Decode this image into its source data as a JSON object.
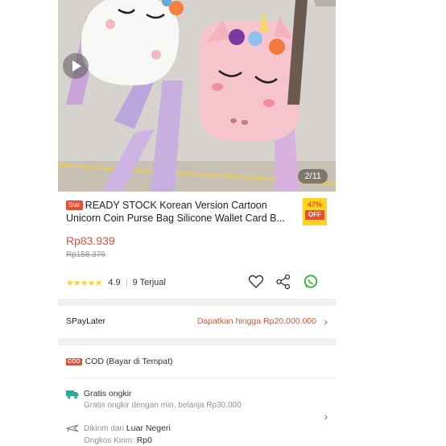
{
  "product": {
    "image_counter": "2/11",
    "badge": "Star",
    "title": "READY STOCK Korean Version Cartoon Unicorn Coin Purse Bag Silicone Wallet Card B...",
    "discount_pct": "47%",
    "discount_label": "OFF",
    "price": "Rp83.939",
    "original_price": "Rp158.376",
    "rating": "4.9",
    "rating_stars": "★★★★★",
    "sold": "9 Terjual"
  },
  "paylater": {
    "label": "SPayLater",
    "offer": "Dapatkan hingga Rp20.000.000"
  },
  "cod": {
    "badge": "COD",
    "label": "COD (Bayar di Tempat)"
  },
  "shipping": {
    "free_title": "Gratis ongkir",
    "free_detail": "Gratis ongkir dengan min. belanja Rp30.000",
    "from_prefix": "Dikirim dari",
    "from_location": "Luar Negeri",
    "cost_prefix": "Ongkos Kirim:",
    "cost_value": "Rp0"
  },
  "colors": {
    "accent": "#ee4d2d",
    "discount_bg": "#ffd424",
    "whatsapp": "#25b33e"
  }
}
